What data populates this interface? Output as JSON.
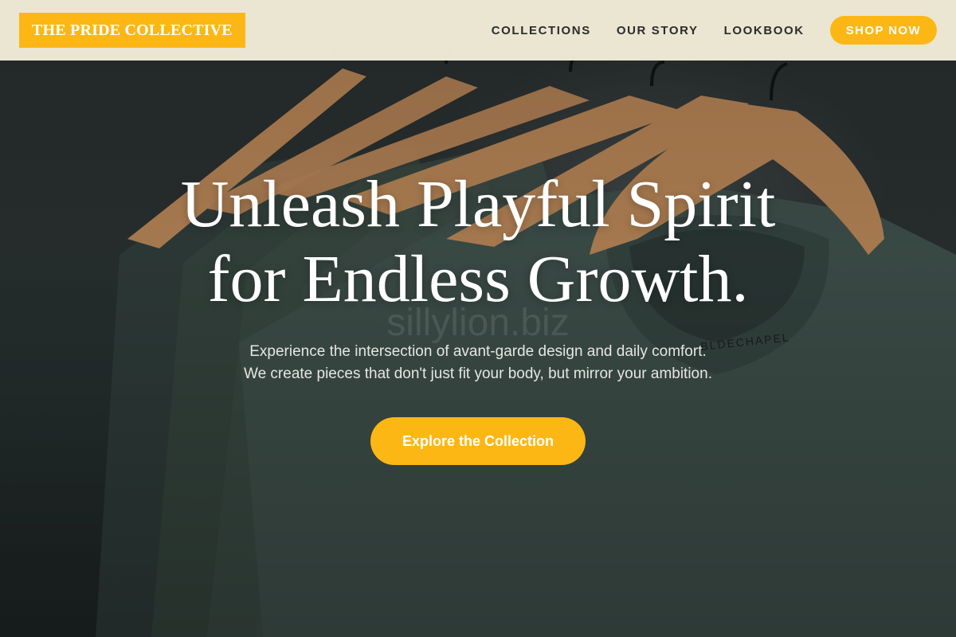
{
  "header": {
    "logo_text": "THE PRIDE COLLECTIVE",
    "nav": [
      {
        "label": "COLLECTIONS"
      },
      {
        "label": "OUR STORY"
      },
      {
        "label": "LOOKBOOK"
      }
    ],
    "cta_label": "SHOP NOW"
  },
  "hero": {
    "title_line1": "Unleash Playful Spirit",
    "title_line2": "for Endless Growth.",
    "subtitle_line1": "Experience the intersection of avant-garde design and daily comfort.",
    "subtitle_line2": "We create pieces that don't just fit your body, but mirror your ambition.",
    "cta_label": "Explore the Collection",
    "watermark": "sillylion.biz",
    "background_image": "t-shirts-on-wooden-hangers"
  },
  "colors": {
    "accent": "#fdb714",
    "header_bg": "#f4eeda",
    "nav_text": "#2b2b2b"
  }
}
